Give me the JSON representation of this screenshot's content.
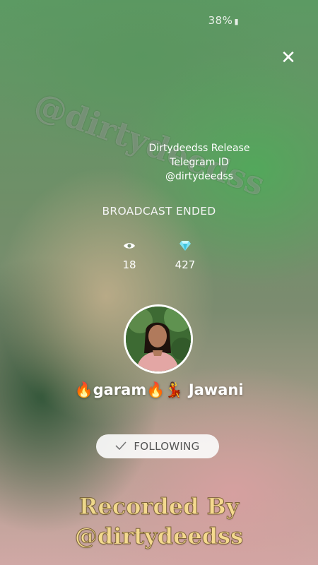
{
  "status": {
    "battery": "38%"
  },
  "watermark": {
    "text": "@dirtydeedss"
  },
  "promo": {
    "line1": "Dirtydeedss Release",
    "line2": "Telegram ID",
    "line3": "@dirtydeedss"
  },
  "broadcast": {
    "status": "BROADCAST ENDED"
  },
  "stats": {
    "viewers": {
      "icon": "eye-icon",
      "value": "18"
    },
    "diamonds": {
      "icon": "diamond-icon",
      "value": "427"
    }
  },
  "profile": {
    "name": "🔥garam🔥💃 Jawani"
  },
  "follow_button": {
    "label": "FOLLOWING"
  },
  "recorded": {
    "line1": "Recorded By",
    "line2": "@dirtydeedss"
  }
}
